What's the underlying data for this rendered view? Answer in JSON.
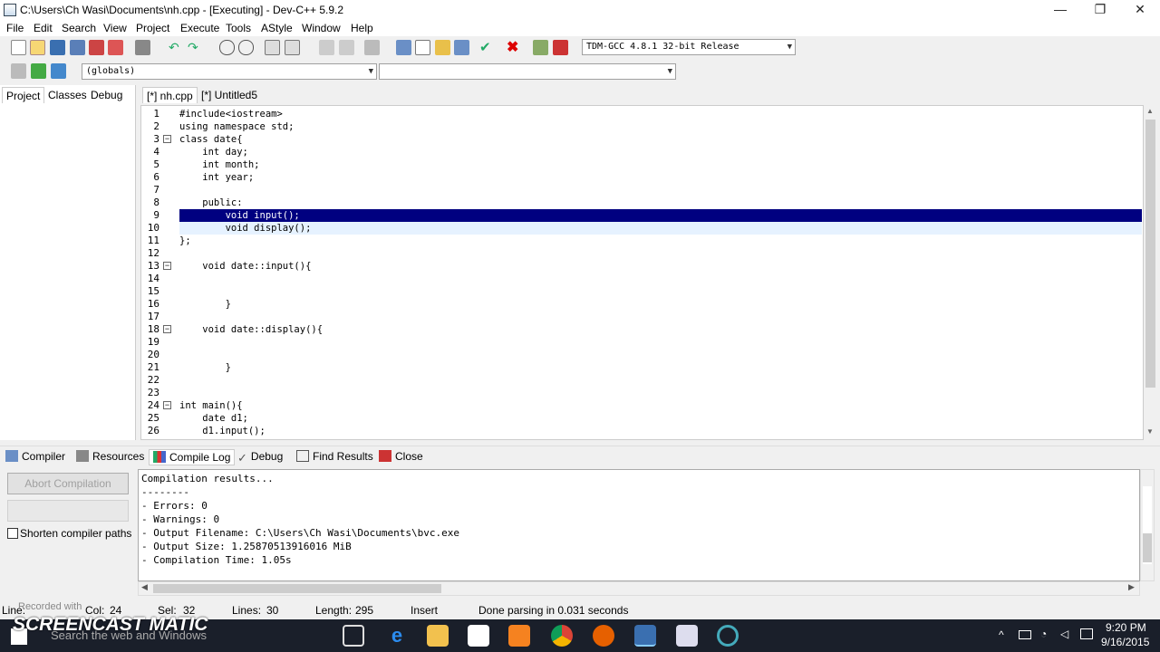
{
  "window": {
    "title": "C:\\Users\\Ch Wasi\\Documents\\nh.cpp - [Executing] - Dev-C++ 5.9.2",
    "minimize_glyph": "—",
    "maximize_glyph": "❐",
    "close_glyph": "✕"
  },
  "menu": [
    "File",
    "Edit",
    "Search",
    "View",
    "Project",
    "Execute",
    "Tools",
    "AStyle",
    "Window",
    "Help"
  ],
  "toolbar": {
    "compiler_select": "TDM-GCC 4.8.1 32-bit Release",
    "scope_select": "(globals)",
    "member_select": ""
  },
  "left_tabs": [
    "Project",
    "Classes",
    "Debug"
  ],
  "editor_tabs": [
    "[*] nh.cpp",
    "[*] Untitled5"
  ],
  "code_lines": [
    {
      "n": "1",
      "text": "#include<iostream>"
    },
    {
      "n": "2",
      "text": "using namespace std;"
    },
    {
      "n": "3",
      "text": "class date{"
    },
    {
      "n": "4",
      "text": "    int day;"
    },
    {
      "n": "5",
      "text": "    int month;"
    },
    {
      "n": "6",
      "text": "    int year;"
    },
    {
      "n": "7",
      "text": ""
    },
    {
      "n": "8",
      "text": "    public:"
    },
    {
      "n": "9",
      "text": "        void input();"
    },
    {
      "n": "10",
      "text": "        void display();"
    },
    {
      "n": "11",
      "text": "};"
    },
    {
      "n": "12",
      "text": ""
    },
    {
      "n": "13",
      "text": "    void date::input(){"
    },
    {
      "n": "14",
      "text": ""
    },
    {
      "n": "15",
      "text": ""
    },
    {
      "n": "16",
      "text": "        }"
    },
    {
      "n": "17",
      "text": ""
    },
    {
      "n": "18",
      "text": "    void date::display(){"
    },
    {
      "n": "19",
      "text": ""
    },
    {
      "n": "20",
      "text": ""
    },
    {
      "n": "21",
      "text": "        }"
    },
    {
      "n": "22",
      "text": ""
    },
    {
      "n": "23",
      "text": ""
    },
    {
      "n": "24",
      "text": "int main(){"
    },
    {
      "n": "25",
      "text": "    date d1;"
    },
    {
      "n": "26",
      "text": "    d1.input();"
    }
  ],
  "bottom_tabs": [
    "Compiler",
    "Resources",
    "Compile Log",
    "Debug",
    "Find Results",
    "Close"
  ],
  "bottom_left": {
    "abort_button": "Abort Compilation",
    "shorten_checkbox": "Shorten compiler paths"
  },
  "compile_log": [
    "Compilation results...",
    "--------",
    "- Errors: 0",
    "- Warnings: 0",
    "- Output Filename: C:\\Users\\Ch Wasi\\Documents\\bvc.exe",
    "- Output Size: 1.25870513916016 MiB",
    "- Compilation Time: 1.05s"
  ],
  "status": {
    "line_label": "Line:",
    "col_label": "Col:",
    "col": "24",
    "sel_label": "Sel:",
    "sel": "32",
    "lines_label": "Lines:",
    "lines": "30",
    "length_label": "Length:",
    "length": "295",
    "mode": "Insert",
    "message": "Done parsing in 0.031 seconds"
  },
  "watermark": {
    "recorded_with": "Recorded with",
    "brand": "SCREENCAST MATIC"
  },
  "taskbar": {
    "search_placeholder": "Search the web and Windows",
    "time": "9:20 PM",
    "date": "9/16/2015"
  }
}
